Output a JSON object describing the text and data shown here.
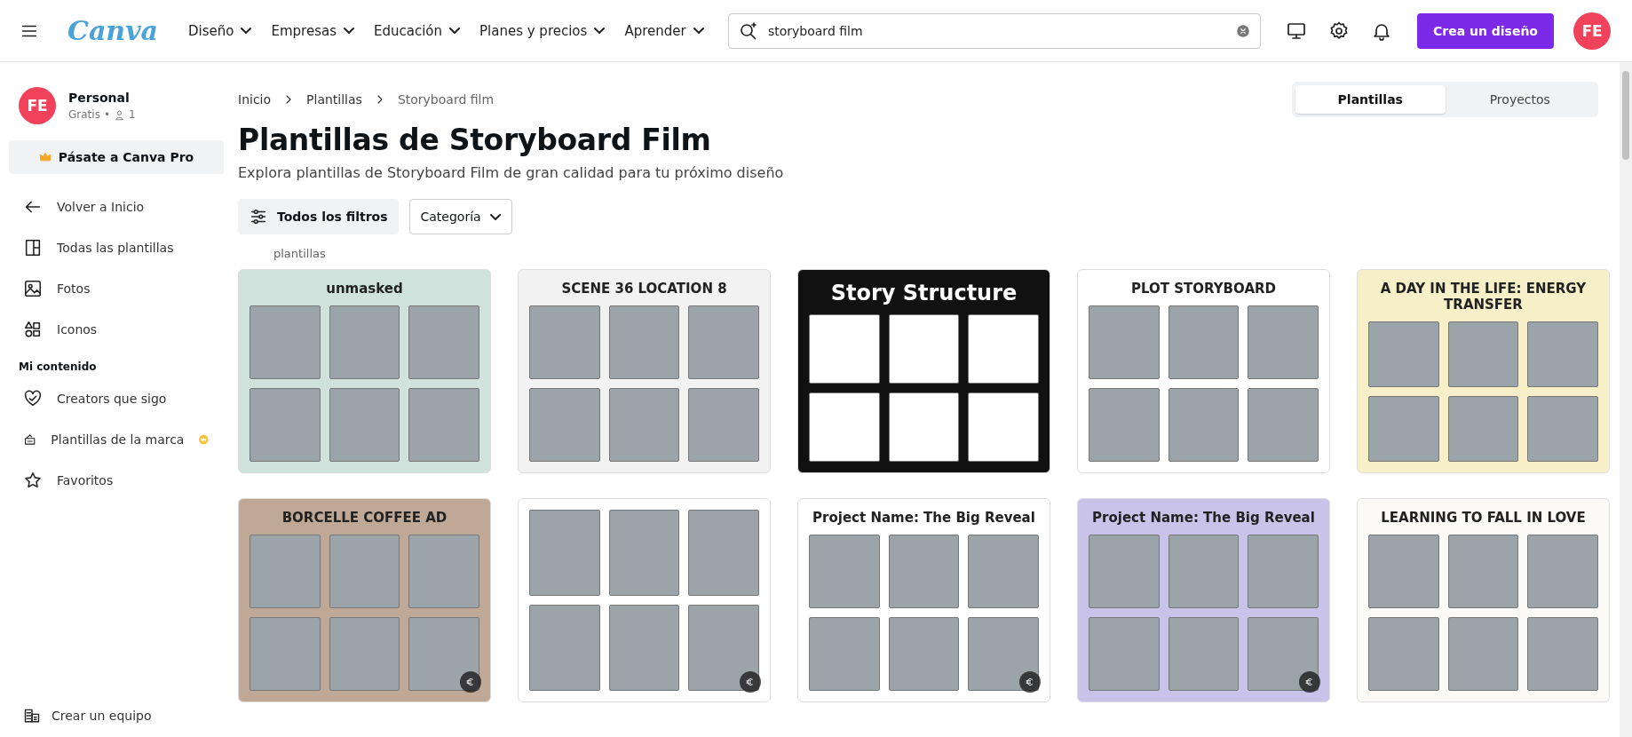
{
  "topbar": {
    "logo": "Canva",
    "nav": [
      {
        "label": "Diseño"
      },
      {
        "label": "Empresas"
      },
      {
        "label": "Educación"
      },
      {
        "label": "Planes y precios"
      },
      {
        "label": "Aprender"
      }
    ],
    "search": {
      "value": "storyboard film"
    },
    "create_button": "Crea un diseño",
    "avatar": "FE"
  },
  "sidebar": {
    "account": {
      "avatar": "FE",
      "name": "Personal",
      "plan": "Gratis",
      "separator": "•",
      "members": "1"
    },
    "upgrade": "Pásate a Canva Pro",
    "nav": [
      {
        "kind": "back",
        "label": "Volver a Inicio"
      },
      {
        "kind": "layout",
        "label": "Todas las plantillas"
      },
      {
        "kind": "photo",
        "label": "Fotos"
      },
      {
        "kind": "shapes",
        "label": "Iconos"
      }
    ],
    "section": "Mi contenido",
    "content": [
      {
        "kind": "heart",
        "label": "Creators que sigo",
        "pro": false
      },
      {
        "kind": "brand",
        "label": "Plantillas de la marca",
        "pro": true
      },
      {
        "kind": "star",
        "label": "Favoritos",
        "pro": false
      }
    ],
    "footer": "Crear un equipo"
  },
  "breadcrumb": [
    "Inicio",
    "Plantillas",
    "Storyboard film"
  ],
  "tabs": [
    {
      "label": "Plantillas",
      "selected": true
    },
    {
      "label": "Proyectos",
      "selected": false
    }
  ],
  "heading": "Plantillas de Storyboard Film",
  "subtitle": "Explora plantillas de Storyboard Film de gran calidad para tu próximo diseño",
  "filters": {
    "all": "Todos los filtros",
    "category": "Categoría"
  },
  "results_label": "plantillas",
  "templates": [
    {
      "title": "unmasked",
      "color": "#cfe3dc",
      "paid": false
    },
    {
      "title": "SCENE 36 LOCATION 8",
      "color": "#f2f2f2",
      "paid": false
    },
    {
      "title": "Story Structure",
      "color": "#111111",
      "paid": false
    },
    {
      "title": "PLOT STORYBOARD",
      "color": "#ffffff",
      "paid": false
    },
    {
      "title": "A DAY IN THE LIFE: ENERGY TRANSFER",
      "color": "#f7efc8",
      "paid": false
    },
    {
      "title": "BORCELLE COFFEE AD",
      "color": "#bfa996",
      "paid": true
    },
    {
      "color": "#ffffff",
      "paid": true
    },
    {
      "title": "Project Name: The Big Reveal",
      "color": "#ffffff",
      "paid": true
    },
    {
      "title": "Project Name: The Big Reveal",
      "color": "#c9c3ea",
      "paid": true
    },
    {
      "title": "LEARNING TO FALL IN LOVE",
      "color": "#fbfaf6",
      "paid": false
    }
  ]
}
